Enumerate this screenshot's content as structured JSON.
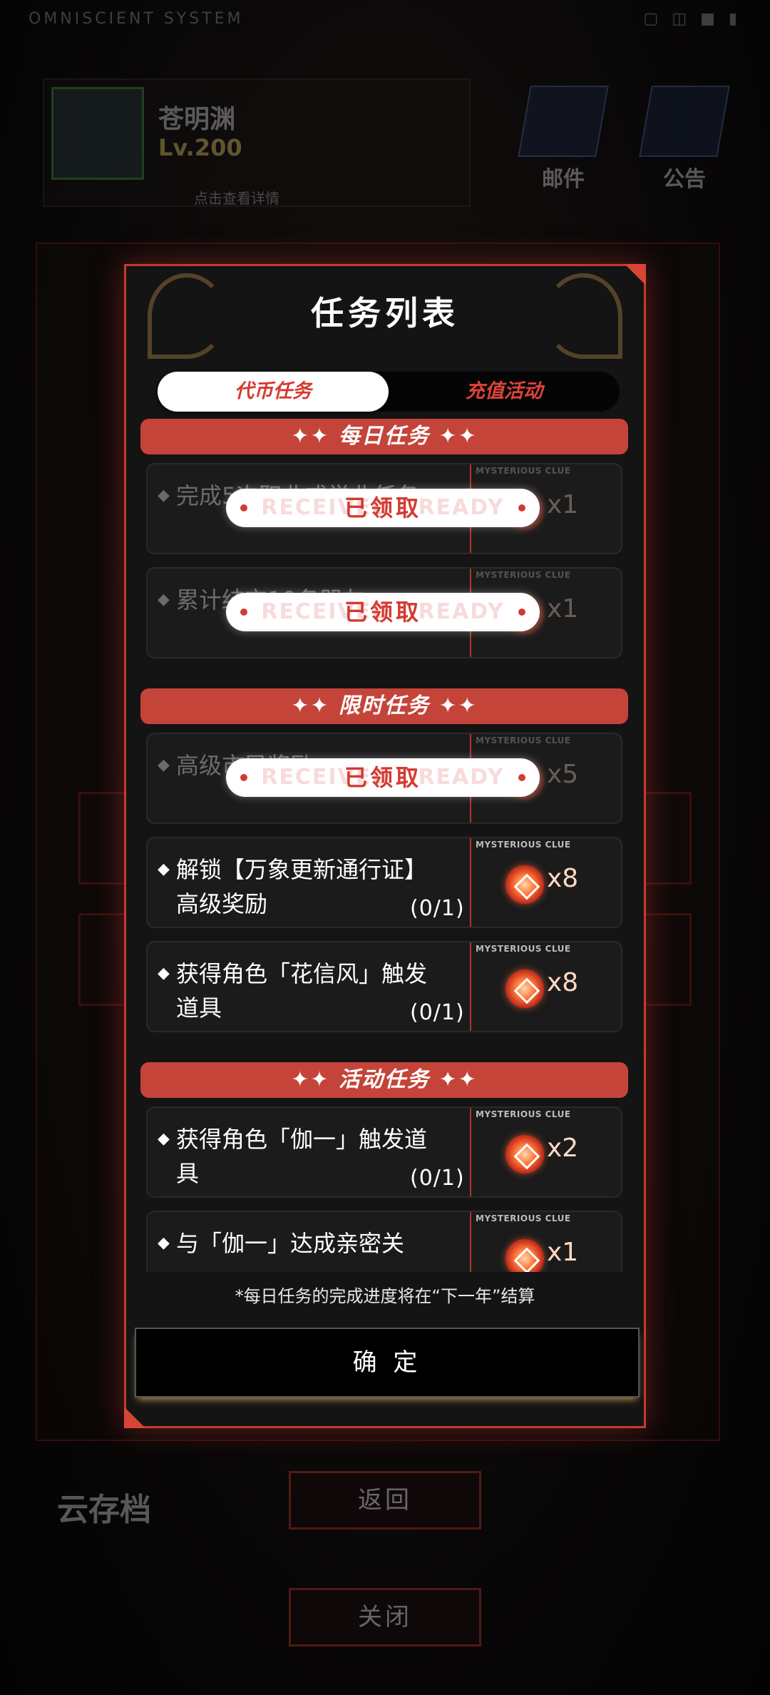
{
  "status_bar": {
    "brand": "OMNISCIENT SYSTEM",
    "icons": "▢ ◫ ■ ▮"
  },
  "background": {
    "player_name": "苍明渊",
    "player_level": "Lv.200",
    "player_detail": "点击查看详情",
    "mail_label": "邮件",
    "notice_label": "公告",
    "back_label": "返回",
    "close_label": "关闭",
    "cloud_save_label": "云存档"
  },
  "modal": {
    "title": "任务列表",
    "tabs": [
      {
        "label": "代币任务",
        "active": true
      },
      {
        "label": "充值活动",
        "active": false
      }
    ],
    "sections": [
      {
        "title": "✦✦ 每日任务 ✦✦"
      },
      {
        "title": "✦✦ 限时任务 ✦✦"
      },
      {
        "title": "✦✦ 活动任务 ✦✦"
      }
    ],
    "reward_label": "MYSTERIOUS CLUE",
    "claimed_label": "已领取",
    "claimed_ghost": "RECEIVED · READY",
    "tasks": [
      {
        "desc": "完成5次职业或学业任务",
        "qty": "x1",
        "progress": "",
        "claimed": true
      },
      {
        "desc": "累计结交10名朋友",
        "qty": "x1",
        "progress": "",
        "claimed": true
      },
      {
        "desc": "高级市民奖励",
        "qty": "x5",
        "progress": "",
        "claimed": true
      },
      {
        "desc": "解锁【万象更新通行证】高级奖励",
        "qty": "x8",
        "progress": "(0/1)",
        "claimed": false
      },
      {
        "desc": "获得角色「花信风」触发道具",
        "qty": "x8",
        "progress": "(0/1)",
        "claimed": false
      },
      {
        "desc": "获得角色「伽一」触发道具",
        "qty": "x2",
        "progress": "(0/1)",
        "claimed": false
      },
      {
        "desc": "与「伽一」达成亲密关",
        "qty": "x1",
        "progress": "",
        "claimed": false
      }
    ],
    "note": "*每日任务的完成进度将在“下一年”结算",
    "confirm_label": "确 定"
  },
  "colors": {
    "accent": "#c4443a",
    "tab_text": "#d43a30",
    "modal_border": "#c23a2e"
  }
}
